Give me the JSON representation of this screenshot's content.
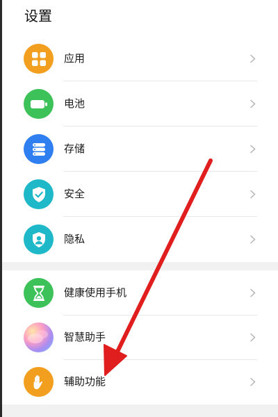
{
  "page": {
    "title": "设置"
  },
  "group1": [
    {
      "id": "apps",
      "label": "应用",
      "icon": "apps-grid-icon",
      "color": "#F29E1F"
    },
    {
      "id": "battery",
      "label": "电池",
      "icon": "battery-icon",
      "color": "#3DC25A"
    },
    {
      "id": "storage",
      "label": "存储",
      "icon": "storage-icon",
      "color": "#2F7FF0"
    },
    {
      "id": "security",
      "label": "安全",
      "icon": "shield-check-icon",
      "color": "#1FB8C8"
    },
    {
      "id": "privacy",
      "label": "隐私",
      "icon": "privacy-person-icon",
      "color": "#1FB8C8"
    }
  ],
  "group2": [
    {
      "id": "digital-balance",
      "label": "健康使用手机",
      "icon": "hourglass-icon",
      "color": "#3DC25A"
    },
    {
      "id": "smart-assistant",
      "label": "智慧助手",
      "icon": "smart-assistant-icon",
      "color": "#B08CE8"
    },
    {
      "id": "accessibility",
      "label": "辅助功能",
      "icon": "hand-icon",
      "color": "#F29E1F"
    }
  ],
  "annotation": {
    "arrow_color": "#E01E1E"
  }
}
